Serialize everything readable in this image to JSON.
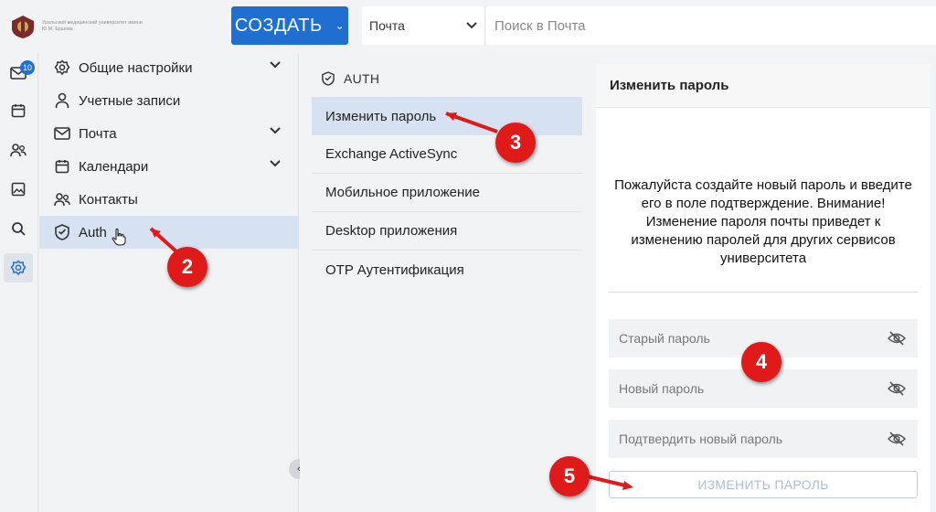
{
  "header": {
    "logo_text": "Уральский медицинский университет имени Ю.М. Ершова",
    "create_label": "СОЗДАТЬ",
    "search_scope": "Почта",
    "search_placeholder": "Поиск в Почта"
  },
  "rail": {
    "items": [
      {
        "icon": "mail-icon",
        "badge": "10"
      },
      {
        "icon": "calendar-icon"
      },
      {
        "icon": "contacts-icon"
      },
      {
        "icon": "image-icon"
      },
      {
        "icon": "search-icon"
      },
      {
        "icon": "settings-icon",
        "active": true
      }
    ]
  },
  "nav": {
    "items": [
      {
        "label": "Общие настройки",
        "icon": "gear-icon",
        "expandable": true
      },
      {
        "label": "Учетные записи",
        "icon": "user-icon"
      },
      {
        "label": "Почта",
        "icon": "mail-icon",
        "expandable": true
      },
      {
        "label": "Календари",
        "icon": "calendar-icon",
        "expandable": true
      },
      {
        "label": "Контакты",
        "icon": "contacts-icon"
      },
      {
        "label": "Auth",
        "icon": "shield-icon",
        "active": true
      }
    ]
  },
  "sub": {
    "header": "AUTH",
    "items": [
      {
        "label": "Изменить пароль",
        "active": true
      },
      {
        "label": "Exchange ActiveSync"
      },
      {
        "label": "Мобильное приложение"
      },
      {
        "label": "Desktop приложения"
      },
      {
        "label": "OTP Аутентификация"
      }
    ]
  },
  "panel": {
    "title": "Изменить пароль",
    "message": "Пожалуйста создайте новый пароль и введите его в поле подтверждение. Внимание! Изменение пароля почты приведет к изменению паролей для других сервисов университета",
    "fields": [
      {
        "placeholder": "Старый пароль"
      },
      {
        "placeholder": "Новый пароль"
      },
      {
        "placeholder": "Подтвердить новый пароль"
      }
    ],
    "submit_label": "ИЗМЕНИТЬ ПАРОЛЬ"
  },
  "markers": [
    "2",
    "3",
    "4",
    "5"
  ],
  "colors": {
    "accent": "#1f6fd1",
    "active_bg": "#d6e1f1",
    "marker": "#e01919"
  }
}
